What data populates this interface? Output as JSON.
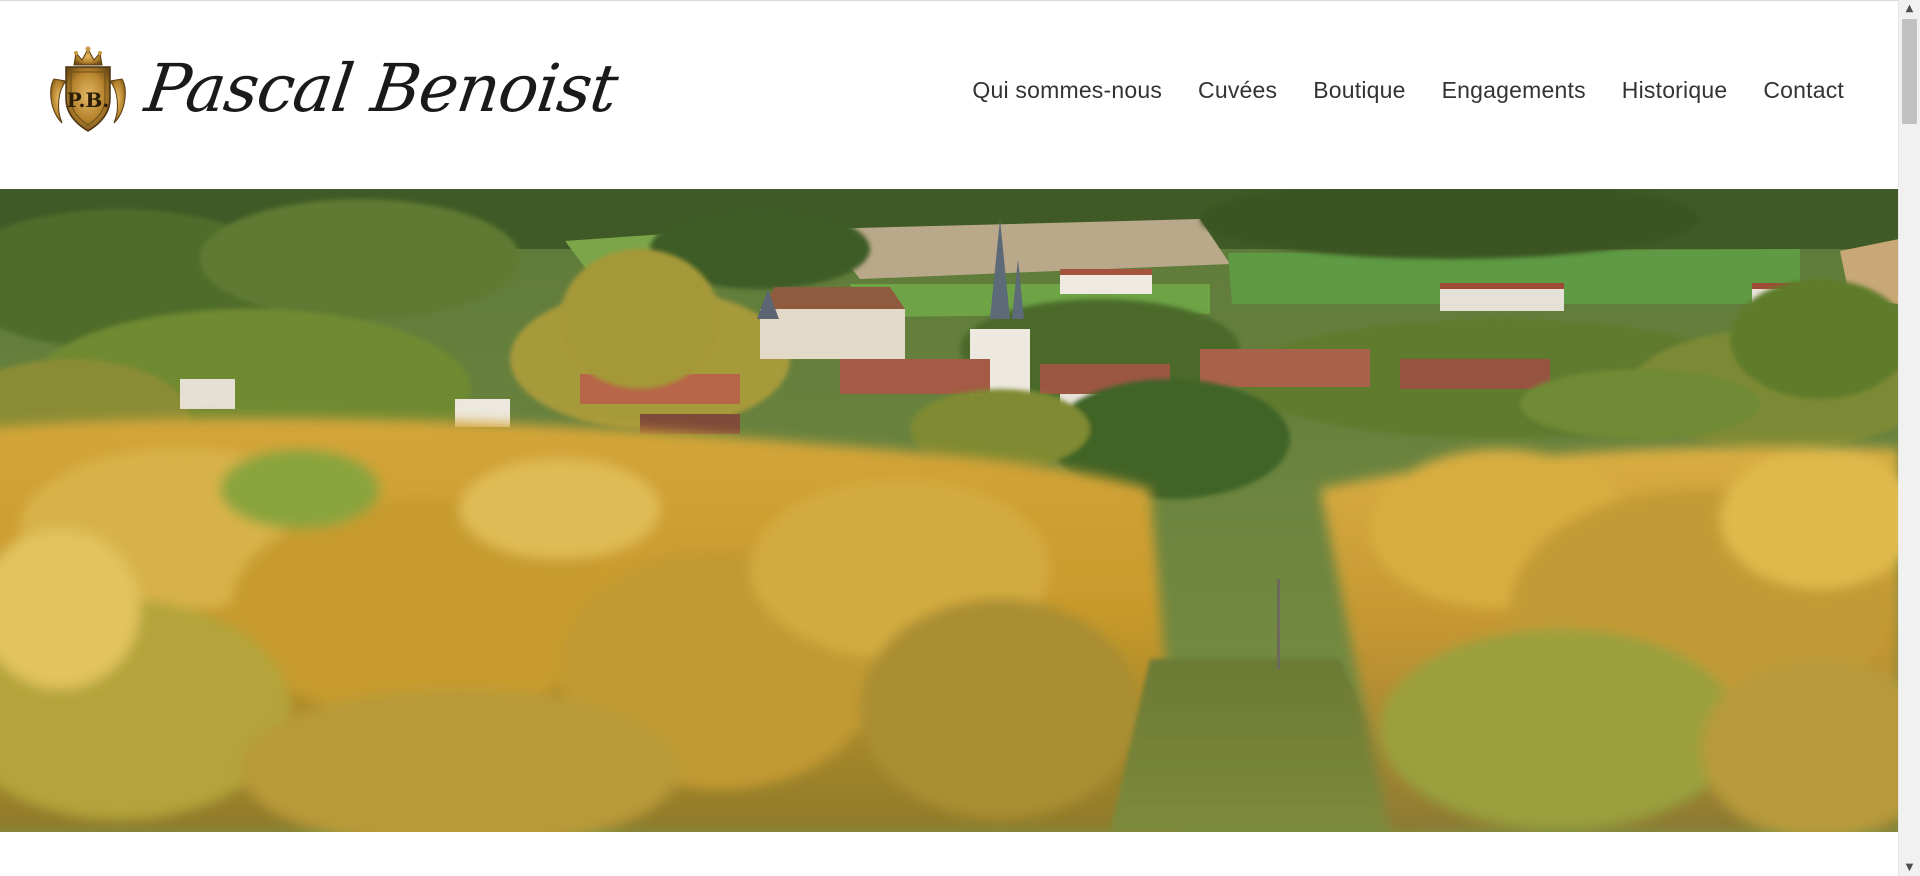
{
  "site": {
    "brand_name": "Pascal Benoist",
    "crest_monogram": "P.B."
  },
  "nav": {
    "items": [
      {
        "label": "Qui sommes-nous"
      },
      {
        "label": "Cuvées"
      },
      {
        "label": "Boutique"
      },
      {
        "label": "Engagements"
      },
      {
        "label": "Historique"
      },
      {
        "label": "Contact"
      }
    ]
  },
  "hero": {
    "image_icon": "vineyard-village-photo-icon"
  },
  "colors": {
    "nav_text": "#333333",
    "brand_text": "#1a1a1a",
    "crest_gold": "#b8862f"
  },
  "icons": {
    "crest": "crest-icon",
    "scroll_up": "chevron-up-icon",
    "scroll_down": "chevron-down-icon"
  }
}
